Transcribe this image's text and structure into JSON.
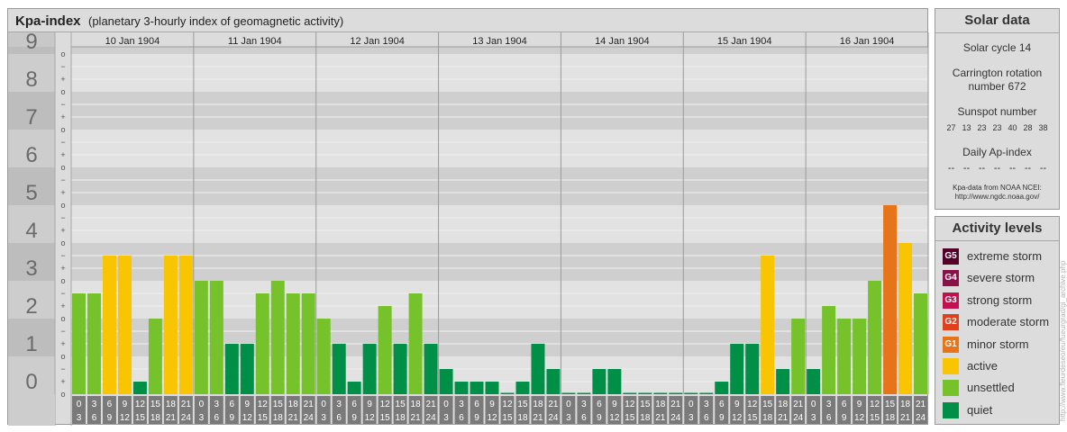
{
  "header": {
    "title": "Kpa-index",
    "subtitle": "(planetary 3-hourly index of geomagnetic activity)"
  },
  "chart_data": {
    "type": "bar",
    "ylim": [
      0,
      9
    ],
    "y_tick_labels": [
      "0",
      "1",
      "2",
      "3",
      "4",
      "5",
      "6",
      "7",
      "8",
      "9"
    ],
    "y_minor_labels": [
      "o",
      "+",
      "−"
    ],
    "days": [
      "10 Jan 1904",
      "11 Jan 1904",
      "12 Jan 1904",
      "13 Jan 1904",
      "14 Jan 1904",
      "15 Jan 1904",
      "16 Jan 1904"
    ],
    "interval_top": [
      "0",
      "3",
      "6",
      "9",
      "12",
      "15",
      "18",
      "21"
    ],
    "interval_bottom": [
      "3",
      "6",
      "9",
      "12",
      "15",
      "18",
      "21",
      "24"
    ],
    "values": [
      [
        2.667,
        2.667,
        3.667,
        3.667,
        0.333,
        2.0,
        3.667,
        3.667
      ],
      [
        3.0,
        3.0,
        1.333,
        1.333,
        2.667,
        3.0,
        2.667,
        2.667
      ],
      [
        2.0,
        1.333,
        0.333,
        1.333,
        2.333,
        1.333,
        2.667,
        1.333
      ],
      [
        0.667,
        0.333,
        0.333,
        0.333,
        0.0,
        0.333,
        1.333,
        0.667
      ],
      [
        0.0,
        0.0,
        0.667,
        0.667,
        0.0,
        0.0,
        0.0,
        0.0
      ],
      [
        0.0,
        0.0,
        0.333,
        1.333,
        1.333,
        3.667,
        0.667,
        2.0
      ],
      [
        0.667,
        2.333,
        2.0,
        2.0,
        3.0,
        5.0,
        4.0,
        2.667
      ]
    ],
    "level_colors": {
      "quiet": "#008f46",
      "unsettled": "#76c22b",
      "active": "#f9c400",
      "G1": "#e6751a",
      "G2": "#e0401c",
      "G3": "#c0124f",
      "G4": "#8a1048",
      "G5": "#55002a"
    },
    "grid": true
  },
  "solar": {
    "title": "Solar data",
    "cycle": "Solar cycle 14",
    "carrington_line1": "Carrington rotation",
    "carrington_line2": "number 672",
    "sunspot_label": "Sunspot number",
    "sunspot_values": [
      "27",
      "13",
      "23",
      "23",
      "40",
      "28",
      "38"
    ],
    "ap_label": "Daily Ap-index",
    "ap_values": [
      "--",
      "--",
      "--",
      "--",
      "--",
      "--",
      "--"
    ],
    "source_line1": "Kpa-data from NOAA NCEI:",
    "source_line2": "http://www.ngdc.noaa.gov/"
  },
  "activity": {
    "title": "Activity levels",
    "levels": [
      {
        "code": "G5",
        "label": "extreme storm",
        "color": "#55002a"
      },
      {
        "code": "G4",
        "label": "severe storm",
        "color": "#8a1048"
      },
      {
        "code": "G3",
        "label": "strong storm",
        "color": "#c0124f"
      },
      {
        "code": "G2",
        "label": "moderate storm",
        "color": "#e0401c"
      },
      {
        "code": "G1",
        "label": "minor storm",
        "color": "#e6751a"
      },
      {
        "code": "",
        "label": "active",
        "color": "#f9c400"
      },
      {
        "code": "",
        "label": "unsettled",
        "color": "#76c22b"
      },
      {
        "code": "",
        "label": "quiet",
        "color": "#008f46"
      }
    ]
  },
  "watermark": "http://www.fleurdeseo/eu/fueurgrad/gi_archive.php"
}
